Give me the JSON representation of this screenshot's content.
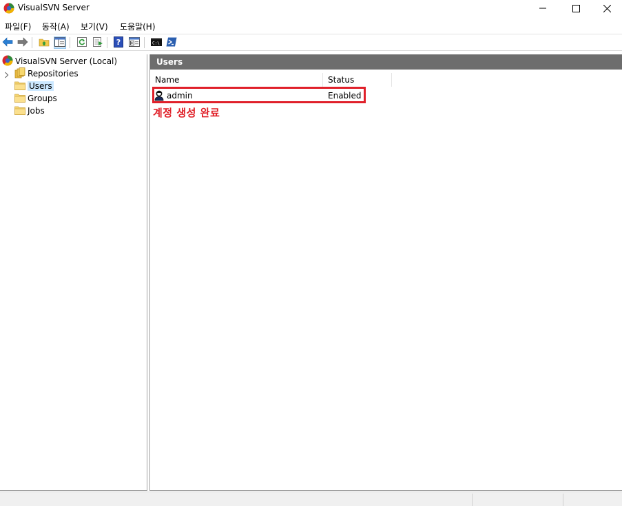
{
  "window": {
    "title": "VisualSVN Server"
  },
  "menu": {
    "items": [
      "파일(F)",
      "동작(A)",
      "보기(V)",
      "도움말(H)"
    ]
  },
  "toolbar": {
    "icons": [
      "back-arrow-icon",
      "forward-arrow-icon",
      "up-folder-icon",
      "show-hide-tree-icon",
      "refresh-icon",
      "export-list-icon",
      "help-icon",
      "properties-view-icon",
      "command-prompt-icon",
      "powershell-icon"
    ],
    "active": "show-hide-tree-icon"
  },
  "tree": {
    "root": "VisualSVN Server (Local)",
    "items": [
      "Repositories",
      "Users",
      "Groups",
      "Jobs"
    ],
    "selected": "Users"
  },
  "list": {
    "header": "Users",
    "columns": [
      "Name",
      "Status"
    ],
    "rows": [
      {
        "name": "admin",
        "status": "Enabled"
      }
    ]
  },
  "annotation": {
    "text": "계정 생성 완료",
    "color": "#e01f27"
  },
  "colors": {
    "pane_header_bg": "#6d6d6d",
    "selection_bg": "#cce8ff",
    "annotation_box": "#e0202a"
  }
}
